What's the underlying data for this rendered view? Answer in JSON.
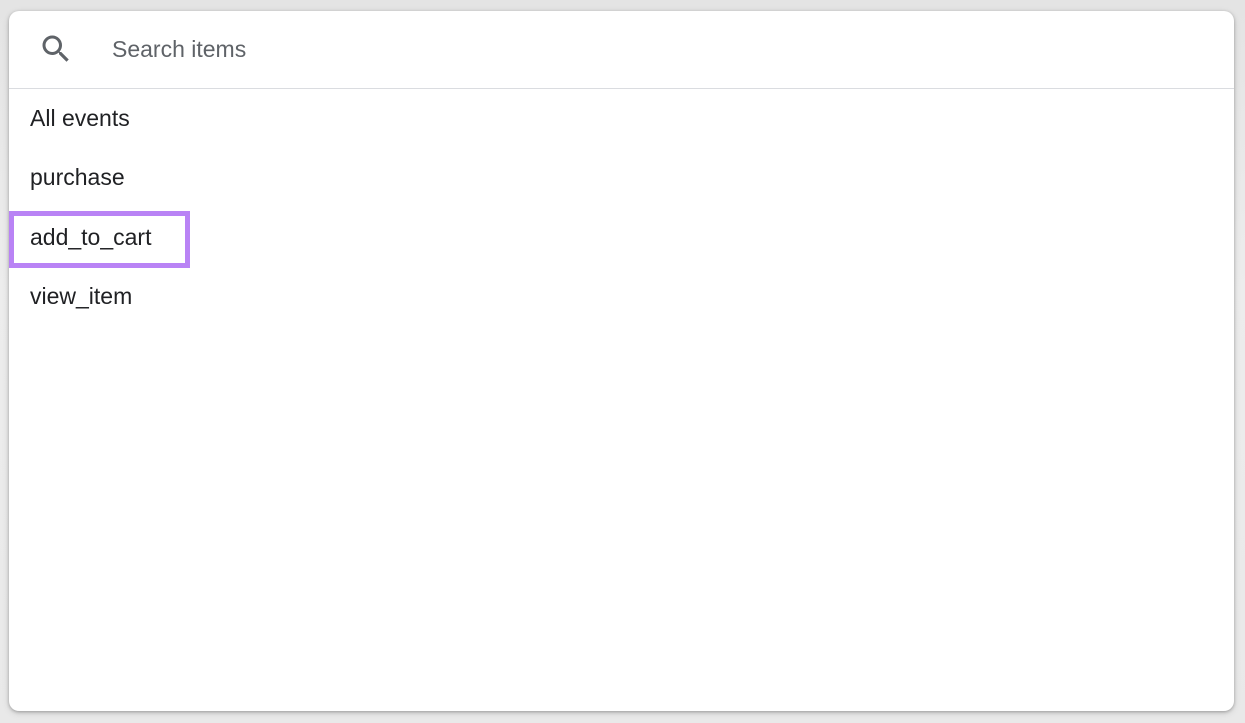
{
  "search": {
    "placeholder": "Search items",
    "value": ""
  },
  "items": [
    {
      "label": "All events"
    },
    {
      "label": "purchase"
    },
    {
      "label": "add_to_cart",
      "highlighted": true
    },
    {
      "label": "view_item"
    }
  ],
  "colors": {
    "highlight_border": "#b983f5",
    "text": "#202124",
    "placeholder": "#5f6368",
    "divider": "#dadce0"
  }
}
